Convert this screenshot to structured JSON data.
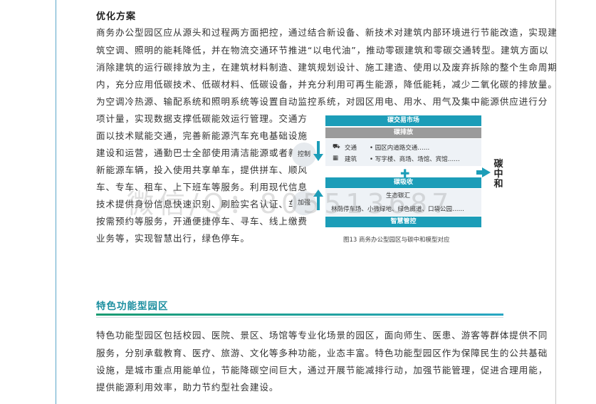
{
  "doc": {
    "heading": "优化方案",
    "paragraph_lines": [
      "商务办公型园区应从源头和过程两方面把控，通过结合新设备、新技术对建筑内部环境进行节能改造，实现建",
      "筑空调、照明的能耗降低，并在物流交通环节推进“以电代油”，推动零碳建筑和零碳交通转型。建筑方面以",
      "消除建筑的运行碳排放为主，在建筑材料制造、建筑规划设计、施工建造、使用以及废弃拆除的整个生命周期",
      "内，充分应用低碳技术、低碳材料、低碳设备，并充分利用可再生能源，降低能耗，减少二氧化碳的排放量。",
      "为空调冷热源、输配系统和照明系统等设置自动监控系统，对园区用电、用水、用气及集中能源供应进行分"
    ],
    "column_lines": [
      "项计量，实现数据支撑低碳能效运行管理。交通方",
      "面以技术赋能交通，完善新能源汽车充电基础设施",
      "建设和运营，通勤巴士全部使用清洁能源或者新增",
      "新能源车辆，投入使用共享单车，提供拼车、顺风",
      "车、专车、租车、上下班车等服务。利用现代信息",
      "技术提供身份信息快速识别、刷脸实名认证、车位",
      "按需预约等服务，开通便捷停车、寻车、线上缴费",
      "业务等，实现智慧出行，绿色停车。"
    ],
    "figure": {
      "band_market": "碳交易市场",
      "band_emission": "碳排放",
      "row_traffic_label": "交通",
      "row_traffic_detail": "• 园区内道路交通……",
      "row_building_label": "建筑",
      "row_building_detail": "• 写字楼、商场、场馆、宾馆……",
      "band_absorb": "碳吸收",
      "sink_label": "生态碳汇",
      "sink_detail": "林荫停车场、小微绿地、绿色廊道、口袋公园……",
      "band_manage": "智慧管控",
      "side_control": "控制",
      "side_increase": "加强",
      "result_label": "碳中和",
      "caption": "图13  商务办公型园区与碳中和模型对应"
    },
    "section_title": "特色功能型园区",
    "section_lines": [
      "特色功能型园区包括校园、医院、景区、场馆等专业化场景的园区，面向师生、医患、游客等群体提供不同",
      "服务，分别承载教育、医疗、旅游、文化等多种功能，业态丰富。特色功能型园区作为保障民生的公共基础",
      "设施，是城市重点用能单位，节能降碳空间巨大，通过开展节能减排行动，加强节能管理，促进合理用能，",
      "提供能源利用效率，助力节约型社会建设。"
    ],
    "watermark": "微信/Q：805513687",
    "colors": {
      "accent": "#1c9db8",
      "title_green": "#1d8fa0"
    }
  }
}
